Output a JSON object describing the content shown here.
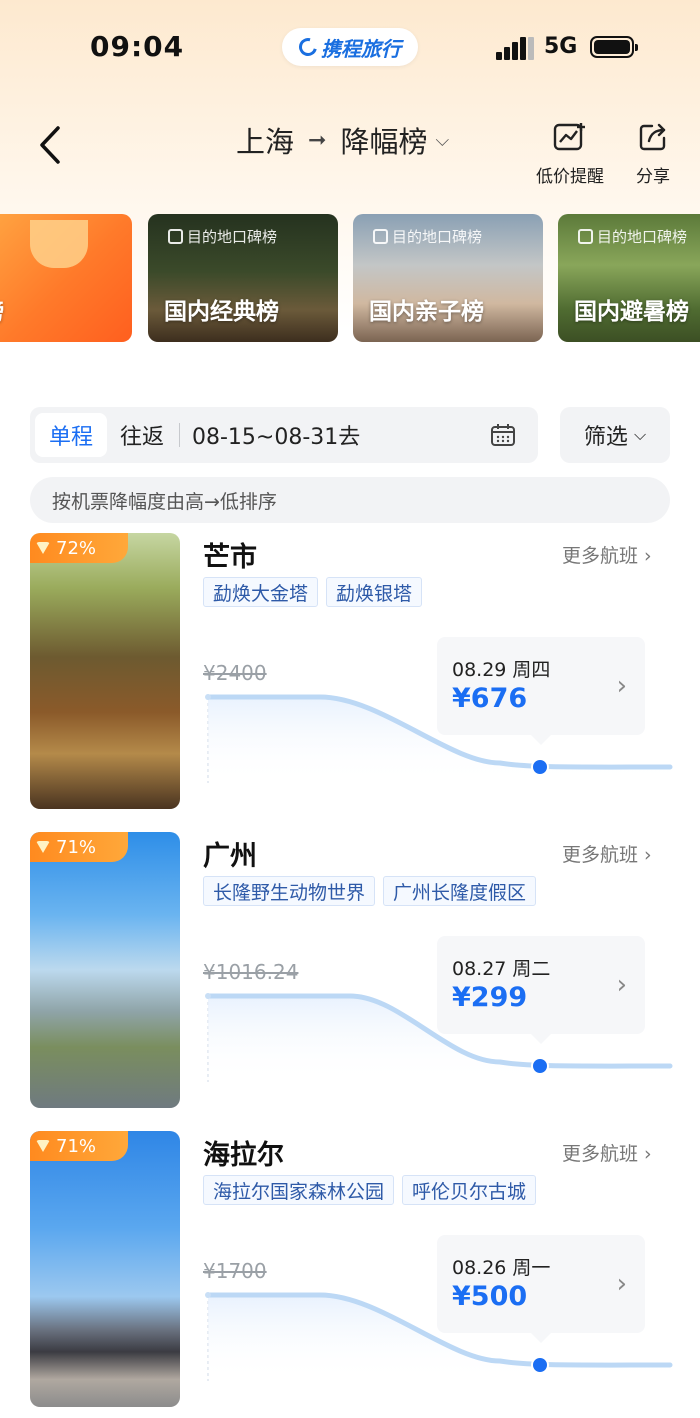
{
  "status": {
    "time": "09:04",
    "app": "携程旅行",
    "network": "5G",
    "battery_level": 1.0
  },
  "nav": {
    "origin": "上海",
    "separator": "➞",
    "ranking": "降幅榜",
    "alert_label": "低价提醒",
    "share_label": "分享"
  },
  "cards": [
    {
      "tag": "",
      "label": "度榜"
    },
    {
      "tag": "目的地口碑榜",
      "label": "国内经典榜"
    },
    {
      "tag": "目的地口碑榜",
      "label": "国内亲子榜"
    },
    {
      "tag": "目的地口碑榜",
      "label": "国内避暑榜"
    }
  ],
  "trip": {
    "one_way": "单程",
    "round_trip": "往返",
    "dates": "08-15~08-31去",
    "filter": "筛选"
  },
  "sort_hint": "按机票降幅度由高→低排序",
  "more_label": "更多航班 ›",
  "destinations": [
    {
      "drop": "72%",
      "name": "芒市",
      "tags": [
        "勐焕大金塔",
        "勐焕银塔"
      ],
      "orig_price": "¥2400",
      "date": "08.29 周四",
      "price": "¥676"
    },
    {
      "drop": "71%",
      "name": "广州",
      "tags": [
        "长隆野生动物世界",
        "广州长隆度假区"
      ],
      "orig_price": "¥1016.24",
      "date": "08.27 周二",
      "price": "¥299"
    },
    {
      "drop": "71%",
      "name": "海拉尔",
      "tags": [
        "海拉尔国家森林公园",
        "呼伦贝尔古城"
      ],
      "orig_price": "¥1700",
      "date": "08.26 周一",
      "price": "¥500"
    }
  ],
  "colors": {
    "accent": "#1b6ef3",
    "badge": "#ff8a1f",
    "tag_text": "#2e5aa8"
  }
}
